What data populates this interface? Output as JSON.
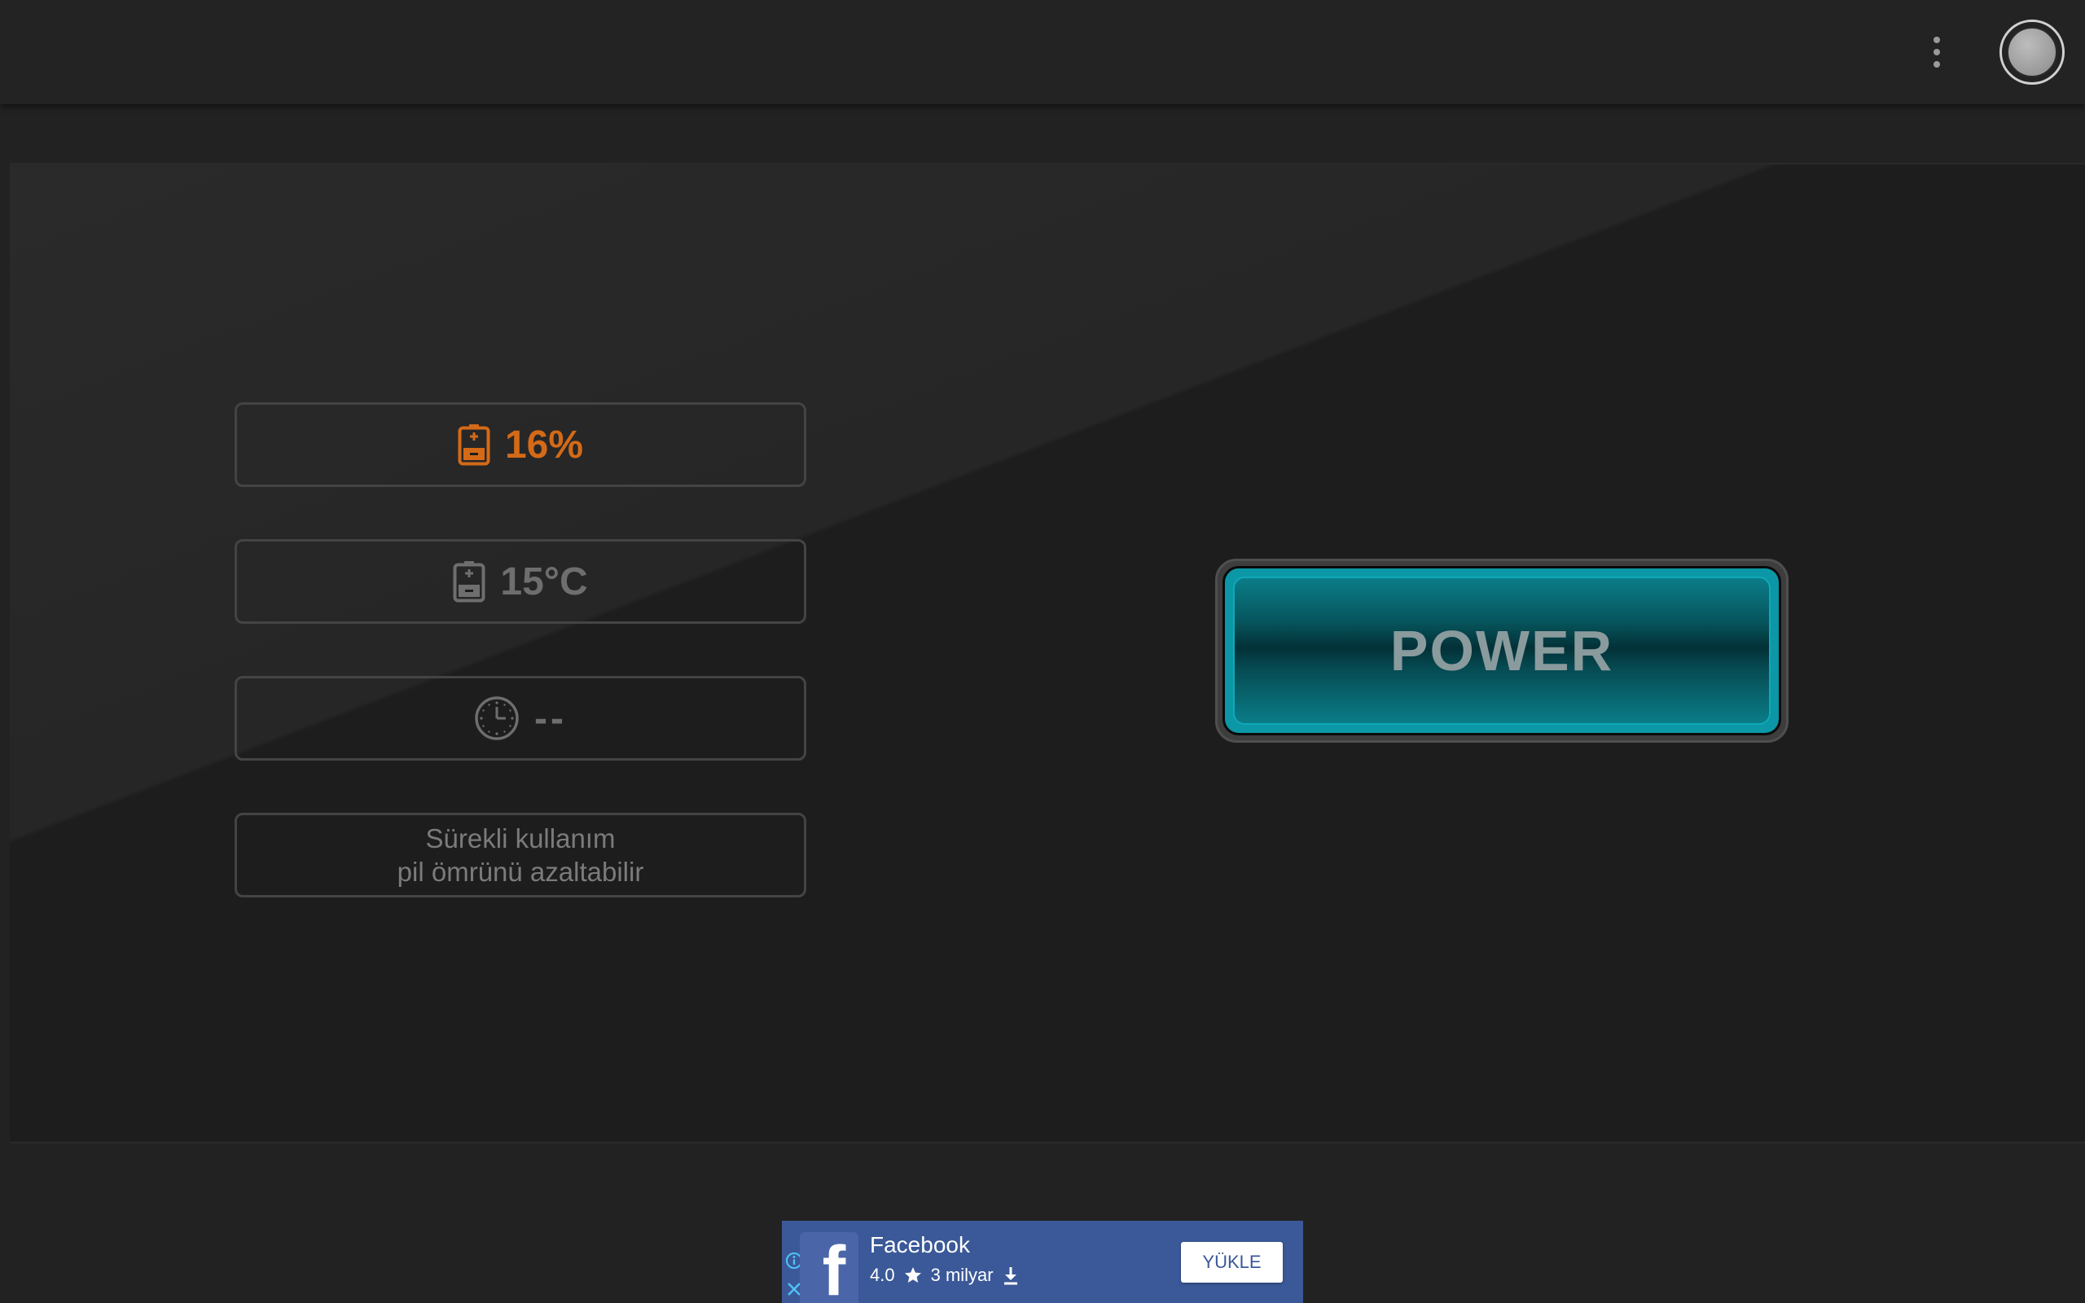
{
  "header": {
    "menu_icon": "more-vertical-icon",
    "avatar_icon": "circle-avatar-icon"
  },
  "stats": {
    "battery": {
      "icon": "battery-icon",
      "value": "16%",
      "color": "#d46a17"
    },
    "temperature": {
      "icon": "battery-icon",
      "value": "15°C",
      "color": "#6e6e6e"
    },
    "time": {
      "icon": "clock-icon",
      "value": "--"
    },
    "warning": {
      "line1": "Sürekli kullanım",
      "line2": "pil ömrünü azaltabilir"
    }
  },
  "power_button": {
    "label": "POWER",
    "accent": "#0b97a6"
  },
  "ad": {
    "app_name": "Facebook",
    "rating": "4.0",
    "installs": "3 milyar",
    "install_label": "YÜKLE",
    "logo_letter": "f",
    "background": "#3b5998"
  }
}
